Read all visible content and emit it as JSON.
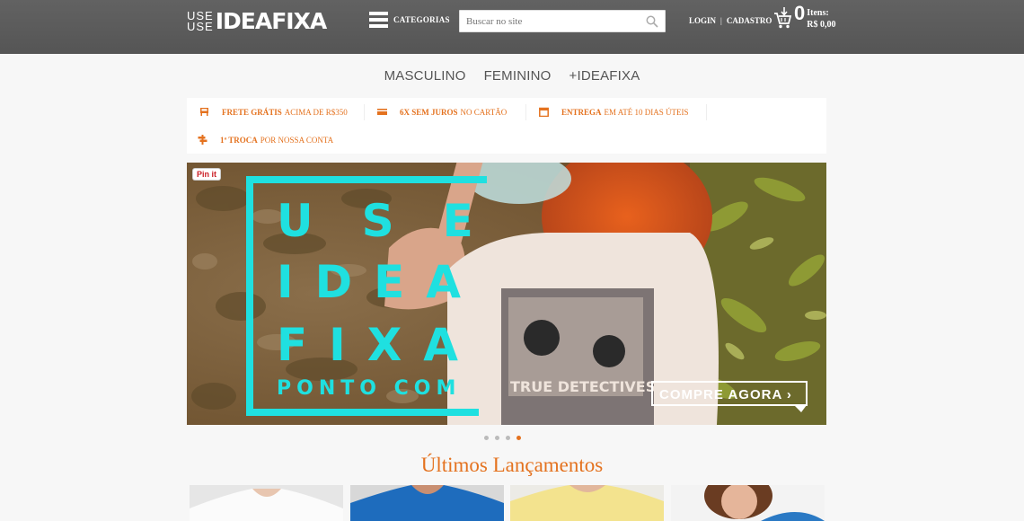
{
  "header": {
    "logo_top": "USE",
    "logo_bottom": "USE",
    "logo_brand": "IDEAFIXA",
    "categories_label": "CATEGORIAS",
    "search_placeholder": "Buscar no site",
    "login_label": "LOGIN",
    "separator": "|",
    "register_label": "CADASTRO",
    "cart_count": "0",
    "cart_items_label": "Itens:",
    "cart_total": "R$ 0,00"
  },
  "nav": {
    "items": [
      "MASCULINO",
      "FEMININO",
      "+IDEAFIXA"
    ]
  },
  "benefits": [
    {
      "bold": "FRETE GRÁTIS",
      "text": "ACIMA DE R$350",
      "icon": "truck-icon"
    },
    {
      "bold": "6X SEM JUROS",
      "text": "NO CARTÃO",
      "icon": "credit-card-icon"
    },
    {
      "bold": "ENTREGA",
      "text": "EM ATÉ 10 DIAS ÚTEIS",
      "icon": "calendar-icon"
    },
    {
      "bold": "1ª TROCA",
      "text": "POR NOSSA CONTA",
      "icon": "exchange-icon"
    }
  ],
  "hero": {
    "pin_label": "Pin it",
    "line1": "USE",
    "line2": "IDEA",
    "line3": "FIXA",
    "line4": "PONTO COM",
    "shirt_text": "TRUE DETECTIVES",
    "cta_label": "COMPRE AGORA ›",
    "slides_total": 4,
    "active_slide": 4
  },
  "section": {
    "title": "Últimos Lançamentos"
  },
  "colors": {
    "accent": "#e4721f",
    "header_bg": "#5c5c5c",
    "hero_cyan": "#1fe0e0"
  }
}
